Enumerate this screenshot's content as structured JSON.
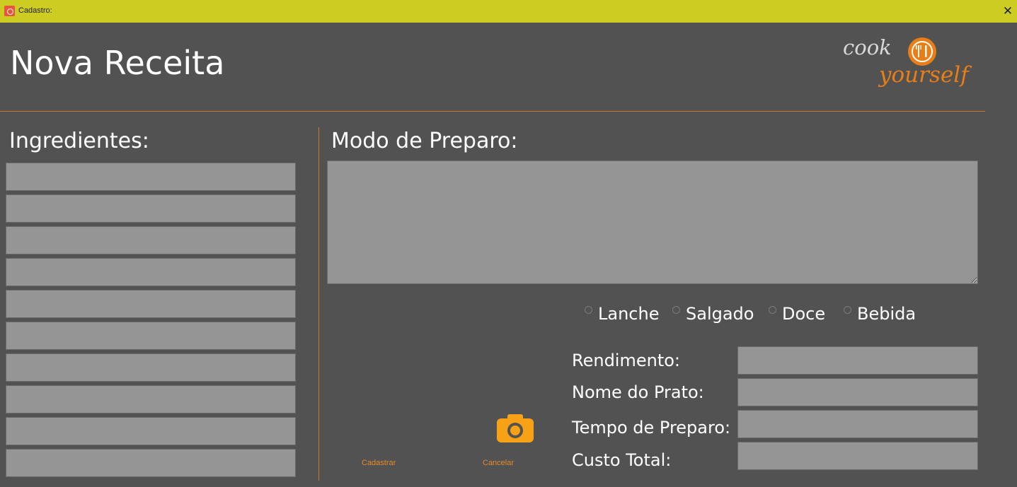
{
  "window": {
    "title": "Cadastro:",
    "close_symbol": "✕"
  },
  "header": {
    "title": "Nova Receita"
  },
  "logo": {
    "line1": "cook",
    "line2": "yourself",
    "accent": "#e97e16"
  },
  "ingredients": {
    "label": "Ingredientes:",
    "fields": [
      "",
      "",
      "",
      "",
      "",
      "",
      "",
      "",
      "",
      ""
    ]
  },
  "preparation": {
    "label": "Modo de Preparo:",
    "value": ""
  },
  "category": {
    "options": [
      {
        "label": "Lanche",
        "selected": false
      },
      {
        "label": "Salgado",
        "selected": false
      },
      {
        "label": "Doce",
        "selected": false
      },
      {
        "label": "Bebida",
        "selected": false
      }
    ]
  },
  "form": {
    "rendimento_label": "Rendimento:",
    "nome_label": "Nome do Prato:",
    "tempo_label": "Tempo de Preparo:",
    "custo_label": "Custo Total:"
  },
  "actions": {
    "save": "Cadastrar",
    "cancel": "Cancelar",
    "photo_icon": "camera-icon"
  },
  "colors": {
    "titlebar": "#cccc22",
    "background": "#525252",
    "field": "#959595",
    "divider": "#c87a2c",
    "action": "#e58a2a"
  }
}
